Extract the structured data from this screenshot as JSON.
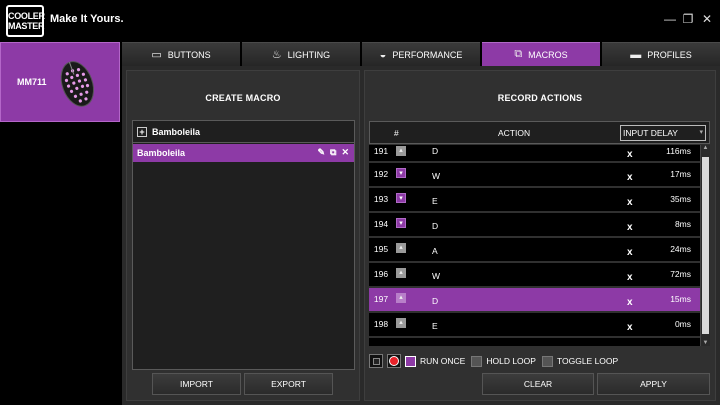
{
  "app": {
    "logo_text": "COOLER MASTER",
    "tagline": "Make It Yours."
  },
  "window_controls": {
    "minimize": "—",
    "restore": "❐",
    "close": "✕"
  },
  "device": {
    "name": "MM711"
  },
  "tabs": [
    {
      "label": "BUTTONS",
      "icon": "mouse-icon",
      "glyph": "▭",
      "active": false
    },
    {
      "label": "LIGHTING",
      "icon": "bulb-icon",
      "glyph": "♨",
      "active": false
    },
    {
      "label": "PERFORMANCE",
      "icon": "gauge-icon",
      "glyph": "◒",
      "active": false
    },
    {
      "label": "MACROS",
      "icon": "macro-icon",
      "glyph": "⧉",
      "active": true
    },
    {
      "label": "PROFILES",
      "icon": "folder-icon",
      "glyph": "▬",
      "active": false
    }
  ],
  "create_macro": {
    "title": "CREATE MACRO",
    "group_label": "Bamboleila",
    "items": [
      "Bamboleila"
    ],
    "import_label": "IMPORT",
    "export_label": "EXPORT"
  },
  "record_actions": {
    "title": "RECORD ACTIONS",
    "columns": {
      "num": "#",
      "action": "ACTION",
      "delay": "INPUT DELAY"
    },
    "rows": [
      {
        "num": "191",
        "dir": "up",
        "key": "D",
        "delay": "116ms"
      },
      {
        "num": "192",
        "dir": "down",
        "key": "W",
        "delay": "17ms"
      },
      {
        "num": "193",
        "dir": "down",
        "key": "E",
        "delay": "35ms"
      },
      {
        "num": "194",
        "dir": "down",
        "key": "D",
        "delay": "8ms"
      },
      {
        "num": "195",
        "dir": "up",
        "key": "A",
        "delay": "24ms"
      },
      {
        "num": "196",
        "dir": "up",
        "key": "W",
        "delay": "72ms"
      },
      {
        "num": "197",
        "dir": "up",
        "key": "D",
        "delay": "15ms",
        "selected": true
      },
      {
        "num": "198",
        "dir": "up",
        "key": "E",
        "delay": "0ms"
      }
    ],
    "delete_glyph": "x",
    "run_once_label": "RUN ONCE",
    "hold_loop_label": "HOLD LOOP",
    "toggle_loop_label": "TOGGLE LOOP",
    "clear_label": "CLEAR",
    "apply_label": "APPLY"
  },
  "colors": {
    "accent": "#8d3aa6",
    "record": "#e8232a"
  }
}
